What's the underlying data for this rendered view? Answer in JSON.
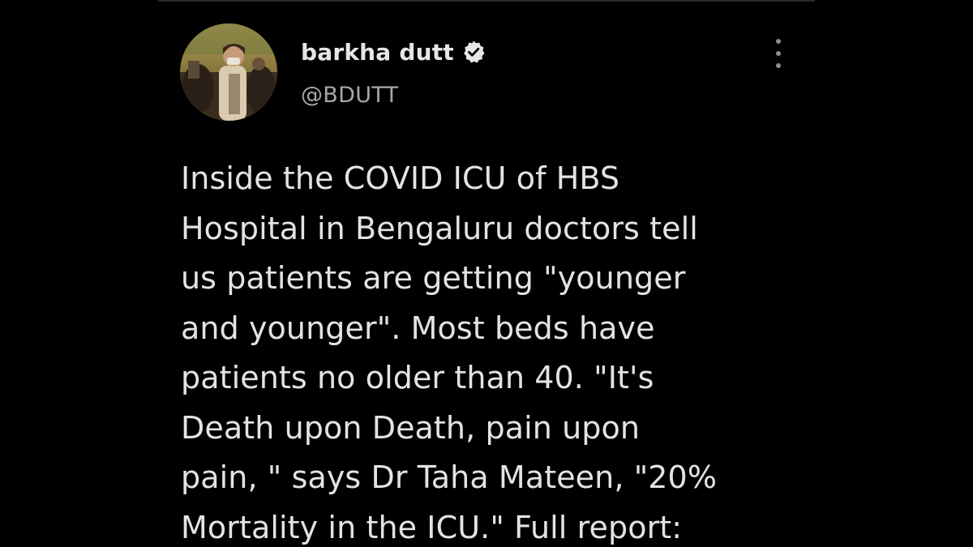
{
  "tweet": {
    "author": {
      "display_name": "barkha dutt",
      "handle": "@BDUTT",
      "verified": true,
      "avatar_icon": "profile-photo"
    },
    "more_icon": "more-vertical-icon",
    "text_lines": [
      "Inside the COVID ICU of HBS",
      "Hospital in Bengaluru doctors tell",
      "us patients are getting \"younger",
      "and younger\". Most beds have",
      "patients no older than 40. \"It's",
      "Death upon Death, pain upon",
      "pain, \" says Dr Taha Mateen, \"20%",
      "Mortality in the ICU.\" Full report:"
    ]
  },
  "colors": {
    "background": "#000000",
    "text_primary": "#e3e3e3",
    "text_secondary": "#a8a8a8",
    "verified_badge": "#e6e6e6"
  }
}
